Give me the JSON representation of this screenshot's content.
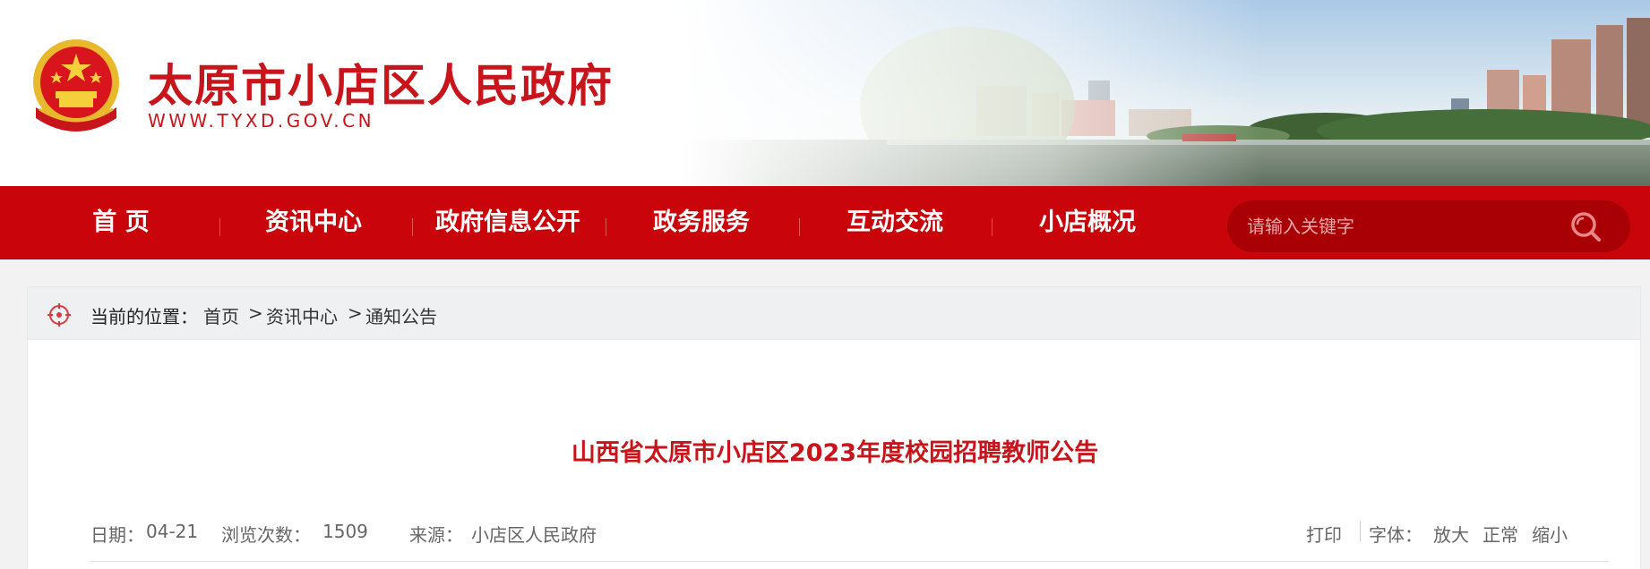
{
  "header": {
    "site_title": "太原市小店区人民政府",
    "site_url": "WWW.TYXD.GOV.CN",
    "brand_color": "#c8141b"
  },
  "nav": {
    "items": [
      {
        "label": "首 页"
      },
      {
        "label": "资讯中心"
      },
      {
        "label": "政府信息公开"
      },
      {
        "label": "政务服务"
      },
      {
        "label": "互动交流"
      },
      {
        "label": "小店概况"
      }
    ],
    "background": "#c9040a",
    "search_placeholder": "请输入关键字",
    "search_icon": "search-icon"
  },
  "breadcrumb": {
    "icon": "location-target-icon",
    "label": "当前的位置：",
    "items": [
      "首页",
      "资讯中心",
      "通知公告"
    ],
    "separator": ">"
  },
  "article": {
    "title": "山西省太原市小店区2023年度校园招聘教师公告",
    "date_label": "日期：",
    "date": "04-21",
    "views_label": "浏览次数：",
    "views": "1509",
    "source_label": "来源：",
    "source": "小店区人民政府",
    "print": "打印",
    "font_label": "字体：",
    "font_large": "放大",
    "font_normal": "正常",
    "font_small": "缩小"
  }
}
